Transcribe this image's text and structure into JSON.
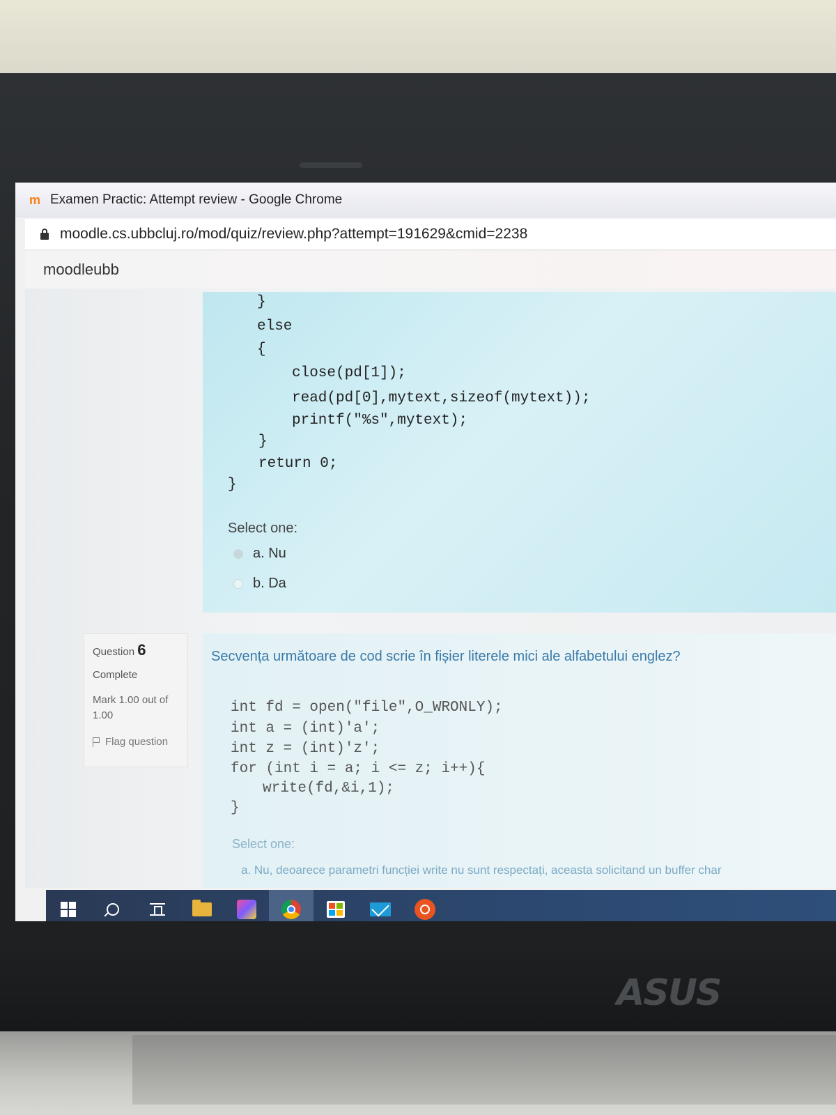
{
  "window": {
    "title": "Examen Practic: Attempt review - Google Chrome",
    "url": "moodle.cs.ubbcluj.ro/mod/quiz/review.php?attempt=191629&cmid=2238"
  },
  "moodle": {
    "brand": "moodleubb"
  },
  "question5": {
    "code_lines": [
      "}",
      "else",
      "{",
      "close(pd[1]);",
      "read(pd[0],mytext,sizeof(mytext));",
      "printf(\"%s\",mytext);",
      "}",
      "return 0;",
      "}"
    ],
    "select_label": "Select one:",
    "options": [
      {
        "label": "a. Nu",
        "selected": true
      },
      {
        "label": "b. Da",
        "selected": false
      }
    ]
  },
  "question6": {
    "info": {
      "question_label": "Question",
      "number": "6",
      "state": "Complete",
      "grade": "Mark 1.00 out of 1.00",
      "flag": "Flag question"
    },
    "text": "Secvența următoare de cod scrie în fișier literele mici ale alfabetului englez?",
    "code_lines": [
      "int fd = open(\"file\",O_WRONLY);",
      "int a = (int)'a';",
      "int z = (int)'z';",
      "for (int i = a; i <= z; i++){",
      "write(fd,&i,1);",
      "}"
    ],
    "select_label": "Select one:",
    "option_a": "a. Nu, deoarece parametri funcției write nu sunt respectați, aceasta solicitand un buffer char"
  },
  "taskbar": {
    "icons": [
      "windows-start-icon",
      "search-icon",
      "task-view-icon",
      "file-explorer-icon",
      "ide-icon",
      "chrome-icon",
      "store-icon",
      "mail-icon",
      "ubuntu-icon"
    ]
  },
  "hardware": {
    "brand_logo": "ASUS"
  },
  "colors": {
    "question_text": "#3a7aa8",
    "question_box": "#c6e9f1",
    "taskbar": "#2c4870"
  }
}
